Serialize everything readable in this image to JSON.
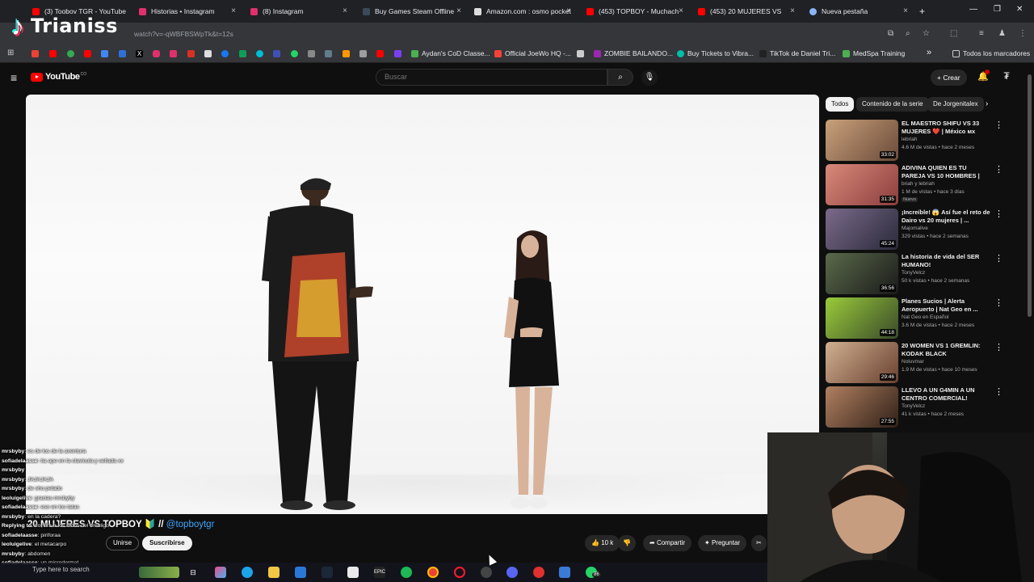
{
  "browser": {
    "tabs": [
      {
        "label": "(3) Toobov TGR - YouTube",
        "color": "#ff0000"
      },
      {
        "label": "Historias • Instagram",
        "color": "#e1306c"
      },
      {
        "label": "(8) Instagram",
        "color": "#e1306c"
      },
      {
        "label": "Buy Games Steam Offline",
        "color": "#1b2838"
      },
      {
        "label": "Amazon.com : osmo pocket",
        "color": "#ff9900"
      },
      {
        "label": "(453) TOPBOY - Muchach",
        "color": "#ff0000"
      },
      {
        "label": "(453) 20 MUJERES VS",
        "color": "#ff0000"
      },
      {
        "label": "Nueva pestaña",
        "color": "#8ab4f8"
      }
    ],
    "new_tab": "+",
    "url": "watch?v=-qWBFBSWpTk&t=12s",
    "bookmarks": [
      {
        "label": "Aydan's CoD Classe...",
        "color": "#4caf50"
      },
      {
        "label": "Official JoeWo HQ -...",
        "color": "#f44336"
      },
      {
        "label": "ZOMBIE BAILANDO...",
        "color": "#9c27b0"
      },
      {
        "label": "Buy Tickets to Vibra...",
        "color": "#00bfa5"
      },
      {
        "label": "TikTok de Daniel Tri...",
        "color": "#000000"
      },
      {
        "label": "MedSpa Training",
        "color": "#4caf50"
      }
    ],
    "bookmarks_overflow": "»",
    "all_bookmarks": "Todos los marcadores"
  },
  "overlay": {
    "streamer_name": "Trianiss"
  },
  "youtube": {
    "logo_text": "YouTube",
    "logo_region": "CO",
    "search_placeholder": "Buscar",
    "create_label": "Crear",
    "video": {
      "title": "20 MUJERES VS TOPBOY",
      "title_suffix": "🔰 //",
      "handle": "@topboytgr",
      "join_label": "Unirse",
      "subscribe_label": "Suscribirse",
      "likes": "10 k",
      "share_label": "Compartir",
      "ask_label": "Preguntar"
    },
    "chips": [
      "Todos",
      "Contenido de la serie",
      "De Jorgenitalex"
    ],
    "recommendations": [
      {
        "title": "EL MAESTRO SHIFU VS 33 MUJERES ❤️ | México мх",
        "channel": "lebriah",
        "meta": "4.6 M de vistas • hace 2 meses",
        "duration": "33:02",
        "colors": [
          "#c9a17a",
          "#6b4a3a"
        ],
        "badge": ""
      },
      {
        "title": "ADIVINA QUIEN ES TU PAREJA VS 10 HOMBRES | MORGAN - ...",
        "channel": "briah y lebriah",
        "meta": "1 M de vistas • hace 3 días",
        "duration": "31:35",
        "colors": [
          "#d98a7a",
          "#8c3d3d"
        ],
        "badge": "Nuevo"
      },
      {
        "title": "¡Increíble! 😱 Así fue el reto de Dairo vs 20 mujeres | ...",
        "channel": "Majomalive",
        "meta": "329 vistas • hace 2 semanas",
        "duration": "45:24",
        "colors": [
          "#7a6a8a",
          "#2a2a3a"
        ],
        "badge": ""
      },
      {
        "title": "La historia de vida del SER HUMANO!",
        "channel": "TonyVelcz",
        "meta": "50 k vistas • hace 2 semanas",
        "duration": "36:56",
        "colors": [
          "#5a6a4a",
          "#1a1a1a"
        ],
        "badge": ""
      },
      {
        "title": "Planes Sucios | Alerta Aeropuerto | Nat Geo en ...",
        "channel": "Nat Geo en Español",
        "meta": "3.6 M de vistas • hace 2 meses",
        "duration": "44:18",
        "colors": [
          "#9acb3a",
          "#3a4a2a"
        ],
        "badge": ""
      },
      {
        "title": "20 WOMEN VS 1 GREMLIN: KODAK BLACK",
        "channel": "Noluvmar",
        "meta": "1.9 M de vistas • hace 10 meses",
        "duration": "29:46",
        "colors": [
          "#d0b090",
          "#6a4030"
        ],
        "badge": ""
      },
      {
        "title": "LLEVO A UN G4MIN A UN CENTRO COMERCIAL!",
        "channel": "TonyVelcz",
        "meta": "41 k vistas • hace 2 meses",
        "duration": "27:55",
        "colors": [
          "#b08060",
          "#302018"
        ],
        "badge": ""
      }
    ]
  },
  "chat": [
    {
      "user": "mrsbyby",
      "msg": "es de los de la aventura"
    },
    {
      "user": "sofiadelaasse",
      "msg": "tia ape en la clavicula y sellada xx"
    },
    {
      "user": "mrsbyby",
      "msg": ""
    },
    {
      "user": "mrsbyby",
      "msg": "JAJAJAJA"
    },
    {
      "user": "mrsbyby",
      "msg": "de sho pelado"
    },
    {
      "user": "leoluigelive",
      "msg": "gracias mrsbyby"
    },
    {
      "user": "sofiadelaasse",
      "msg": "eso en los tatas"
    },
    {
      "user": "mrsbyby",
      "msg": "en la cadera?"
    },
    {
      "user": "Replying to",
      "msg": "no, era a los lados del ombligo"
    },
    {
      "user": "sofiadelaasse",
      "msg": "piriforaa"
    },
    {
      "user": "leoluigelive",
      "msg": "el metacarpo"
    },
    {
      "user": "mrsbyby",
      "msg": "abdomen"
    },
    {
      "user": "sofiadelaasse",
      "msg": "un microdermal"
    }
  ],
  "taskbar": {
    "search_placeholder": "Type here to search",
    "badge": "86"
  }
}
